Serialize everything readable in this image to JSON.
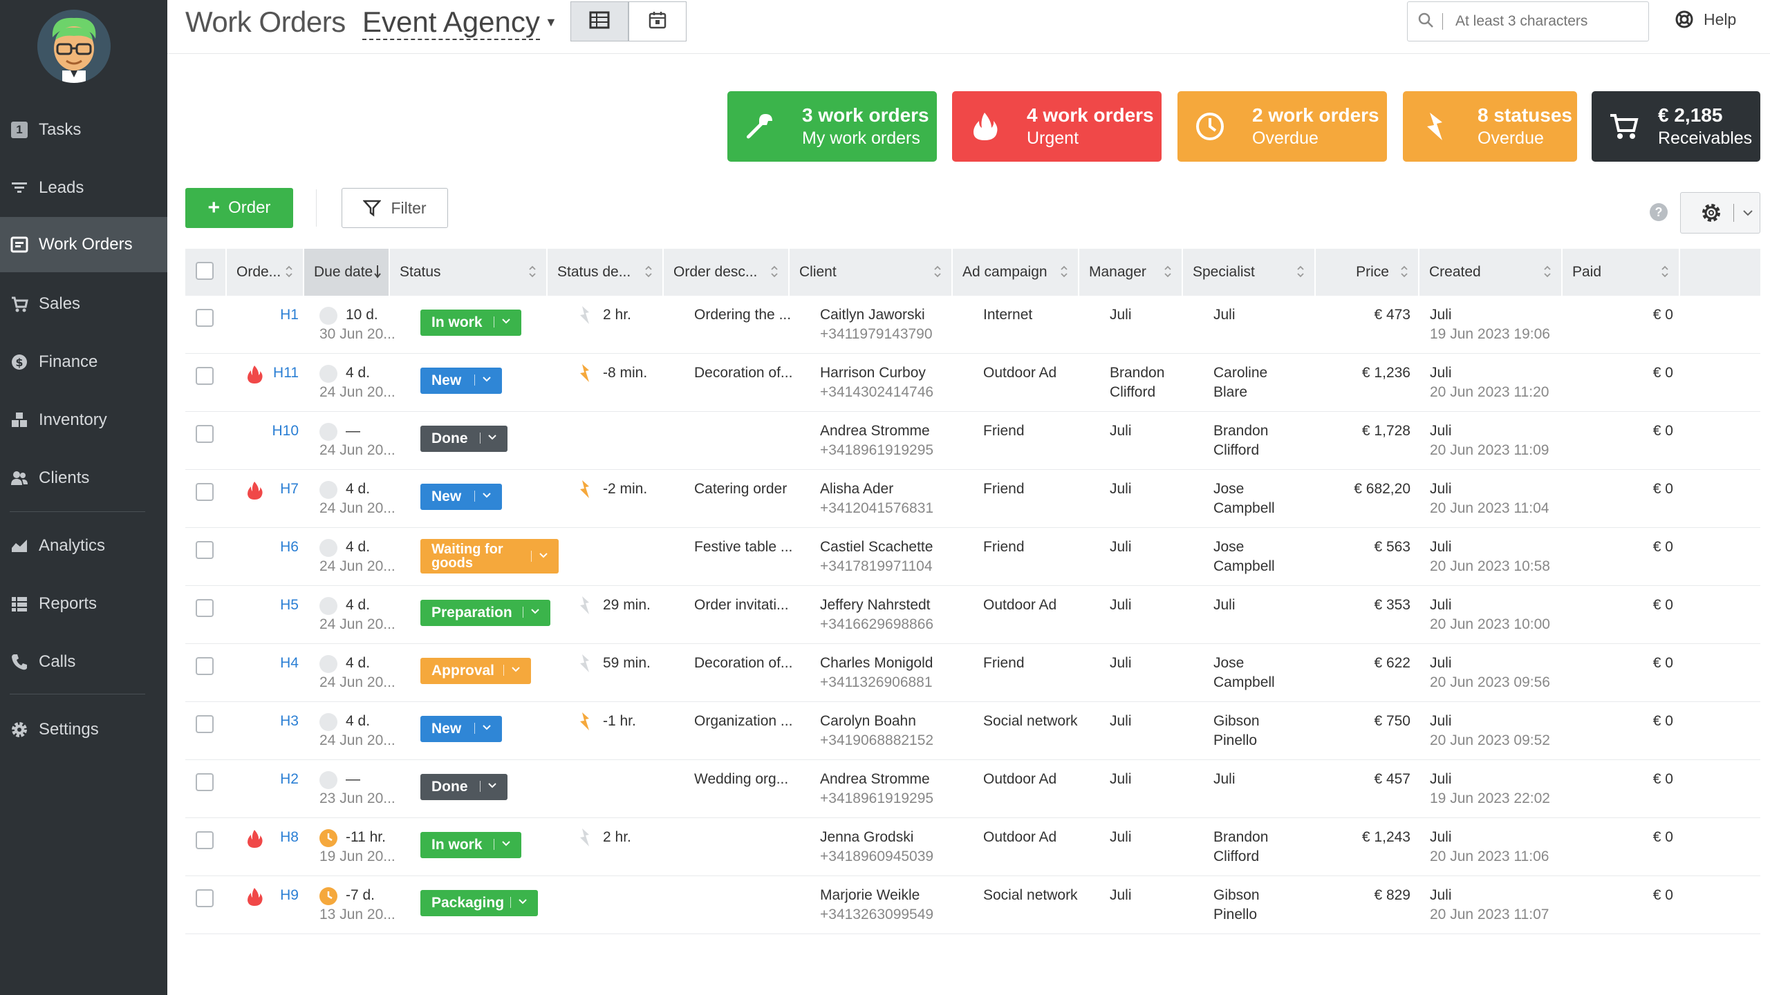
{
  "sidebar": {
    "items": [
      {
        "label": "Tasks",
        "icon": "tasks-badge-icon",
        "badge": "1"
      },
      {
        "label": "Leads",
        "icon": "funnel-icon"
      },
      {
        "label": "Work Orders",
        "icon": "work-orders-icon",
        "active": true
      },
      {
        "label": "Sales",
        "icon": "cart-icon"
      },
      {
        "label": "Finance",
        "icon": "dollar-icon"
      },
      {
        "label": "Inventory",
        "icon": "boxes-icon"
      },
      {
        "label": "Clients",
        "icon": "users-icon"
      },
      {
        "label": "Analytics",
        "icon": "chart-icon"
      },
      {
        "label": "Reports",
        "icon": "reports-icon"
      },
      {
        "label": "Calls",
        "icon": "phone-icon"
      },
      {
        "label": "Settings",
        "icon": "gear-icon"
      }
    ]
  },
  "header": {
    "title": "Work Orders",
    "agency": "Event Agency",
    "search_placeholder": "At least 3 characters",
    "help_label": "Help"
  },
  "kpis": [
    {
      "main": "3 work orders",
      "sub": "My work orders",
      "color": "#3bb44b",
      "icon": "wrench-icon"
    },
    {
      "main": "4 work orders",
      "sub": "Urgent",
      "color": "#f04848",
      "icon": "fire-icon"
    },
    {
      "main": "2 work orders",
      "sub": "Overdue",
      "color": "#f5a83c",
      "icon": "clock-icon"
    },
    {
      "main": "8 statuses",
      "sub": "Overdue",
      "color": "#f5a83c",
      "icon": "lightning-icon"
    },
    {
      "main": "€ 2,185",
      "sub": "Receivables",
      "color": "#2d3236",
      "icon": "cart-icon"
    }
  ],
  "toolbar": {
    "add_label": "Order",
    "filter_label": "Filter",
    "help_dot": "?"
  },
  "table": {
    "columns": [
      "Orde...",
      "Due date",
      "Status",
      "Status de...",
      "Order desc...",
      "Client",
      "Ad campaign",
      "Manager",
      "Specialist",
      "Price",
      "Created",
      "Paid"
    ],
    "rows": [
      {
        "id": "H1",
        "urgent": false,
        "clock": "grey",
        "due": "10 d.",
        "due_date": "30 Jun 20...",
        "status": "In work",
        "status_color": "#3bb44b",
        "bolt": "grey",
        "status_time": "2 hr.",
        "desc": "Ordering the ...",
        "client": "Caitlyn Jaworski",
        "phone": "+3411979143790",
        "ad": "Internet",
        "manager": [
          "Juli"
        ],
        "specialist": [
          "Juli"
        ],
        "price": "€ 473",
        "created_by": "Juli",
        "created": "19 Jun 2023 19:06",
        "paid": "€ 0"
      },
      {
        "id": "H11",
        "urgent": true,
        "clock": "grey",
        "due": "4 d.",
        "due_date": "24 Jun 20...",
        "status": "New",
        "status_color": "#2f86d6",
        "bolt": "orange",
        "status_time": "-8 min.",
        "desc": "Decoration of...",
        "client": "Harrison Curboy",
        "phone": "+3414302414746",
        "ad": "Outdoor Ad",
        "manager": [
          "Brandon",
          "Clifford"
        ],
        "specialist": [
          "Caroline",
          "Blare"
        ],
        "price": "€ 1,236",
        "created_by": "Juli",
        "created": "20 Jun 2023 11:20",
        "paid": "€ 0"
      },
      {
        "id": "H10",
        "urgent": false,
        "clock": "grey",
        "due": "—",
        "due_date": "24 Jun 20...",
        "status": "Done",
        "status_color": "#50575d",
        "bolt": "",
        "status_time": "",
        "desc": "",
        "client": "Andrea Stromme",
        "phone": "+3418961919295",
        "ad": "Friend",
        "manager": [
          "Juli"
        ],
        "specialist": [
          "Brandon",
          "Clifford"
        ],
        "price": "€ 1,728",
        "created_by": "Juli",
        "created": "20 Jun 2023 11:09",
        "paid": "€ 0"
      },
      {
        "id": "H7",
        "urgent": true,
        "clock": "grey",
        "due": "4 d.",
        "due_date": "24 Jun 20...",
        "status": "New",
        "status_color": "#2f86d6",
        "bolt": "orange",
        "status_time": "-2 min.",
        "desc": "Catering order",
        "client": "Alisha Ader",
        "phone": "+3412041576831",
        "ad": "Friend",
        "manager": [
          "Juli"
        ],
        "specialist": [
          "Jose",
          "Campbell"
        ],
        "price": "€ 682,20",
        "created_by": "Juli",
        "created": "20 Jun 2023 11:04",
        "paid": "€ 0"
      },
      {
        "id": "H6",
        "urgent": false,
        "clock": "grey",
        "due": "4 d.",
        "due_date": "24 Jun 20...",
        "status": "Waiting for goods",
        "status_color": "#f5a83c",
        "bolt": "",
        "status_time": "",
        "desc": "Festive table ...",
        "client": "Castiel Scachette",
        "phone": "+3417819971104",
        "ad": "Friend",
        "manager": [
          "Juli"
        ],
        "specialist": [
          "Jose",
          "Campbell"
        ],
        "price": "€ 563",
        "created_by": "Juli",
        "created": "20 Jun 2023 10:58",
        "paid": "€ 0"
      },
      {
        "id": "H5",
        "urgent": false,
        "clock": "grey",
        "due": "4 d.",
        "due_date": "24 Jun 20...",
        "status": "Preparation",
        "status_color": "#3bb44b",
        "bolt": "grey",
        "status_time": "29 min.",
        "desc": "Order invitati...",
        "client": "Jeffery Nahrstedt",
        "phone": "+3416629698866",
        "ad": "Outdoor Ad",
        "manager": [
          "Juli"
        ],
        "specialist": [
          "Juli"
        ],
        "price": "€ 353",
        "created_by": "Juli",
        "created": "20 Jun 2023 10:00",
        "paid": "€ 0"
      },
      {
        "id": "H4",
        "urgent": false,
        "clock": "grey",
        "due": "4 d.",
        "due_date": "24 Jun 20...",
        "status": "Approval",
        "status_color": "#f5a83c",
        "bolt": "grey",
        "status_time": "59 min.",
        "desc": "Decoration of...",
        "client": "Charles Monigold",
        "phone": "+3411326906881",
        "ad": "Friend",
        "manager": [
          "Juli"
        ],
        "specialist": [
          "Jose",
          "Campbell"
        ],
        "price": "€ 622",
        "created_by": "Juli",
        "created": "20 Jun 2023 09:56",
        "paid": "€ 0"
      },
      {
        "id": "H3",
        "urgent": false,
        "clock": "grey",
        "due": "4 d.",
        "due_date": "24 Jun 20...",
        "status": "New",
        "status_color": "#2f86d6",
        "bolt": "orange",
        "status_time": "-1 hr.",
        "desc": "Organization ...",
        "client": "Carolyn Boahn",
        "phone": "+3419068882152",
        "ad": "Social network",
        "manager": [
          "Juli"
        ],
        "specialist": [
          "Gibson",
          "Pinello"
        ],
        "price": "€ 750",
        "created_by": "Juli",
        "created": "20 Jun 2023 09:52",
        "paid": "€ 0"
      },
      {
        "id": "H2",
        "urgent": false,
        "clock": "grey",
        "due": "—",
        "due_date": "23 Jun 20...",
        "status": "Done",
        "status_color": "#50575d",
        "bolt": "",
        "status_time": "",
        "desc": "Wedding org...",
        "client": "Andrea Stromme",
        "phone": "+3418961919295",
        "ad": "Outdoor Ad",
        "manager": [
          "Juli"
        ],
        "specialist": [
          "Juli"
        ],
        "price": "€ 457",
        "created_by": "Juli",
        "created": "19 Jun 2023 22:02",
        "paid": "€ 0"
      },
      {
        "id": "H8",
        "urgent": true,
        "clock": "orange",
        "due": "-11 hr.",
        "due_date": "19 Jun 20...",
        "status": "In work",
        "status_color": "#3bb44b",
        "bolt": "grey",
        "status_time": "2 hr.",
        "desc": "",
        "client": "Jenna Grodski",
        "phone": "+3418960945039",
        "ad": "Outdoor Ad",
        "manager": [
          "Juli"
        ],
        "specialist": [
          "Brandon",
          "Clifford"
        ],
        "price": "€ 1,243",
        "created_by": "Juli",
        "created": "20 Jun 2023 11:06",
        "paid": "€ 0"
      },
      {
        "id": "H9",
        "urgent": true,
        "clock": "orange",
        "due": "-7 d.",
        "due_date": "13 Jun 20...",
        "status": "Packaging",
        "status_color": "#3bb44b",
        "bolt": "",
        "status_time": "",
        "desc": "",
        "client": "Marjorie Weikle",
        "phone": "+3413263099549",
        "ad": "Social network",
        "manager": [
          "Juli"
        ],
        "specialist": [
          "Gibson",
          "Pinello"
        ],
        "price": "€ 829",
        "created_by": "Juli",
        "created": "20 Jun 2023 11:07",
        "paid": "€ 0"
      }
    ]
  }
}
